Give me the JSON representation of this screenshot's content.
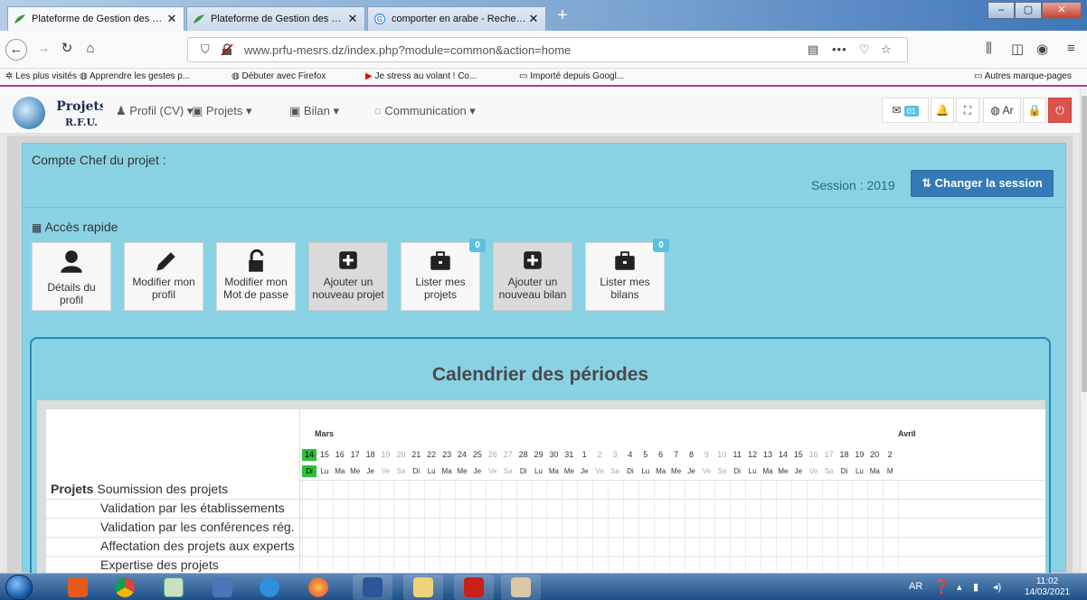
{
  "browser": {
    "tabs": [
      {
        "title": "Plateforme de Gestion des Proj",
        "active": true
      },
      {
        "title": "Plateforme de Gestion des Proj",
        "active": false
      },
      {
        "title": "comporter en arabe - Recherch",
        "active": false
      }
    ],
    "url": "www.prfu-mesrs.dz/index.php?module=common&action=home",
    "bookmarks": [
      "Les plus visités",
      "Apprendre les gestes p...",
      "Débuter avec Firefox",
      "Je stress au volant ! Co...",
      "Importé depuis Googl..."
    ],
    "other_bookmarks": "Autres marque-pages"
  },
  "app": {
    "logo": {
      "line1": "Projets",
      "line2": "R.F.U."
    },
    "menu": [
      {
        "label": "Profil (CV)",
        "icon": "user-icon"
      },
      {
        "label": "Projets",
        "icon": "briefcase-icon"
      },
      {
        "label": "Bilan",
        "icon": "briefcase-icon"
      },
      {
        "label": "Communication",
        "icon": "chat-icon"
      }
    ],
    "mail_count": "01",
    "lang_label": "Ar"
  },
  "dashboard": {
    "account_title": "Compte Chef du projet :",
    "session_label": "Session : 2019",
    "change_session_label": "Changer la session",
    "quick_access_title": "Accès rapide",
    "tiles": [
      {
        "label": "Détails du profil",
        "icon": "user-icon",
        "badge": null
      },
      {
        "label": "Modifier mon profil",
        "icon": "pencil-icon",
        "badge": null
      },
      {
        "label": "Modifier mon Mot de passe",
        "icon": "unlock-icon",
        "badge": null
      },
      {
        "label": "Ajouter un nouveau projet",
        "icon": "plus-square-icon",
        "badge": null
      },
      {
        "label": "Lister mes projets",
        "icon": "briefcase-icon",
        "badge": "0"
      },
      {
        "label": "Ajouter un nouveau bilan",
        "icon": "plus-square-icon",
        "badge": null
      },
      {
        "label": "Lister mes bilans",
        "icon": "briefcase-icon",
        "badge": "0"
      }
    ]
  },
  "calendar": {
    "title": "Calendrier des périodes",
    "months": [
      "Mars",
      "Avril"
    ],
    "days": [
      "14",
      "15",
      "16",
      "17",
      "18",
      "19",
      "20",
      "21",
      "22",
      "23",
      "24",
      "25",
      "26",
      "27",
      "28",
      "29",
      "30",
      "31",
      "1",
      "2",
      "3",
      "4",
      "5",
      "6",
      "7",
      "8",
      "9",
      "10",
      "11",
      "12",
      "13",
      "14",
      "15",
      "16",
      "17",
      "18",
      "19",
      "20",
      "2"
    ],
    "day_names": [
      "Di",
      "Lu",
      "Ma",
      "Me",
      "Je",
      "Ve",
      "Sa",
      "Di",
      "Lu",
      "Ma",
      "Me",
      "Je",
      "Ve",
      "Sa",
      "Di",
      "Lu",
      "Ma",
      "Me",
      "Je",
      "Ve",
      "Sa",
      "Di",
      "Lu",
      "Ma",
      "Me",
      "Je",
      "Ve",
      "Sa",
      "Di",
      "Lu",
      "Ma",
      "Me",
      "Je",
      "Ve",
      "Sa",
      "Di",
      "Lu",
      "Ma",
      "M"
    ],
    "group_label": "Projets",
    "rows": [
      "Soumission des projets",
      "Validation par les établissements",
      "Validation par les conférences rég.",
      "Affectation des projets aux experts",
      "Expertise des projets"
    ]
  },
  "taskbar": {
    "lang": "AR",
    "time": "11:02",
    "date": "14/03/2021"
  }
}
